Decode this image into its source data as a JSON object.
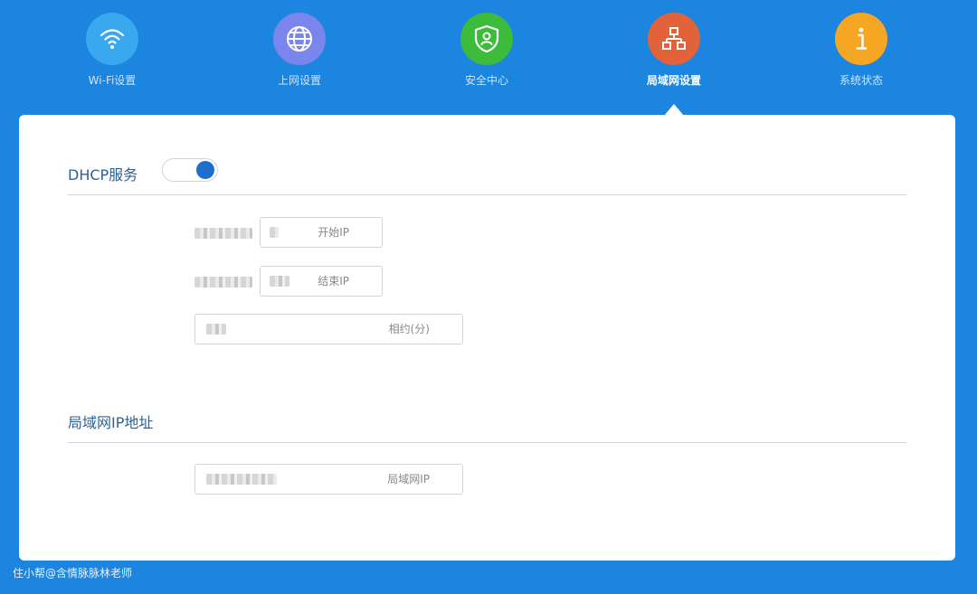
{
  "nav": {
    "items": [
      {
        "label": "Wi-Fi设置",
        "icon": "wifi-icon",
        "color": "#3aa8ef",
        "active": false
      },
      {
        "label": "上网设置",
        "icon": "globe-icon",
        "color": "#7b86ec",
        "active": false
      },
      {
        "label": "安全中心",
        "icon": "shield-user-icon",
        "color": "#3dbb3b",
        "active": false
      },
      {
        "label": "局域网设置",
        "icon": "network-topology-icon",
        "color": "#e2623a",
        "active": true
      },
      {
        "label": "系统状态",
        "icon": "info-icon",
        "color": "#f5a623",
        "active": false
      }
    ]
  },
  "dhcp": {
    "title": "DHCP服务",
    "enabled": true,
    "start_ip_placeholder": "开始IP",
    "end_ip_placeholder": "结束IP",
    "lease_placeholder": "相约(分)"
  },
  "lan": {
    "title": "局域网IP地址",
    "ip_placeholder": "局域网IP"
  },
  "watermark": "住小帮@含情脉脉林老师",
  "colors": {
    "background": "#1c85df",
    "panel": "#ffffff",
    "section_title": "#2f5f92",
    "toggle_on": "#1e6fcc"
  }
}
